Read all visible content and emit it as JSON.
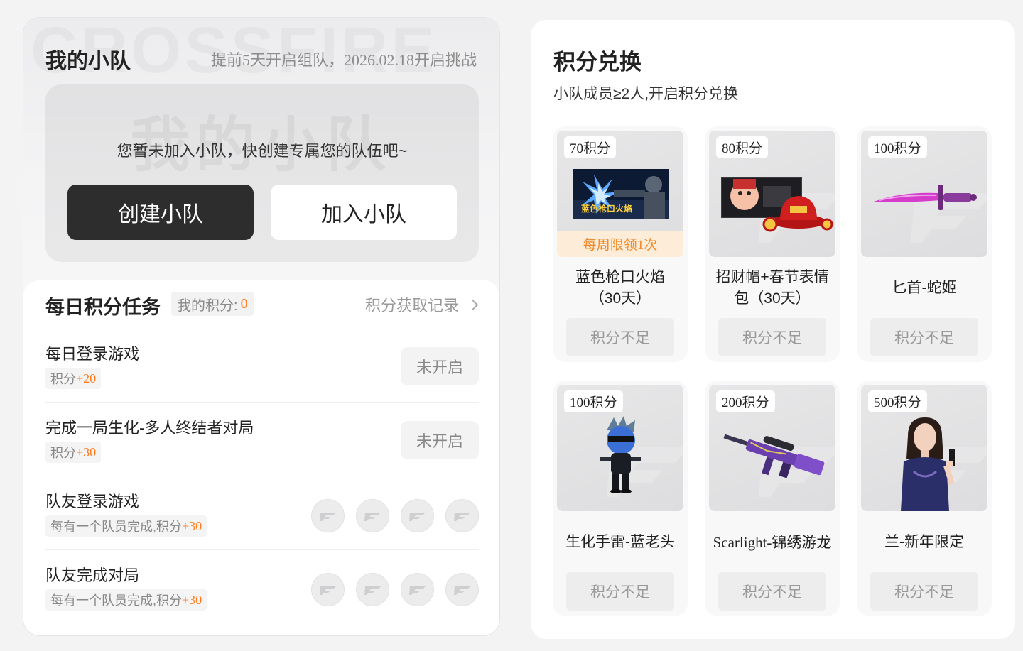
{
  "team": {
    "watermark": "CROSSFIRE",
    "watermark_cn": "我的小队",
    "title": "我的小队",
    "notice": "提前5天开启组队，2026.02.18开启挑战",
    "empty_text": "您暂未加入小队，快创建专属您的队伍吧~",
    "create_label": "创建小队",
    "join_label": "加入小队"
  },
  "tasks": {
    "title": "每日积分任务",
    "my_points_label": "我的积分:",
    "my_points_value": "0",
    "record_label": "积分获取记录",
    "items": [
      {
        "name": "每日登录游戏",
        "reward_label": "积分",
        "reward_value": "+20",
        "action": "未开启"
      },
      {
        "name": "完成一局生化-多人终结者对局",
        "reward_label": "积分",
        "reward_value": "+30",
        "action": "未开启"
      },
      {
        "name": "队友登录游戏",
        "reward_label": "每有一个队员完成,积分",
        "reward_value": "+30"
      },
      {
        "name": "队友完成对局",
        "reward_label": "每有一个队员完成,积分",
        "reward_value": "+30"
      }
    ]
  },
  "exchange": {
    "title": "积分兑换",
    "subtitle": "小队成员≥2人,开启积分兑换",
    "button_label": "积分不足",
    "items": [
      {
        "cost": "70积分",
        "name": "蓝色枪口火焰（30天）",
        "limit": "每周限领1次",
        "image_caption": "蓝色枪口火焰"
      },
      {
        "cost": "80积分",
        "name": "招财帽+春节表情包（30天）"
      },
      {
        "cost": "100积分",
        "name": "匕首-蛇姬"
      },
      {
        "cost": "100积分",
        "name": "生化手雷-蓝老头"
      },
      {
        "cost": "200积分",
        "name": "Scarlight-锦绣游龙"
      },
      {
        "cost": "500积分",
        "name": "兰-新年限定"
      }
    ]
  }
}
